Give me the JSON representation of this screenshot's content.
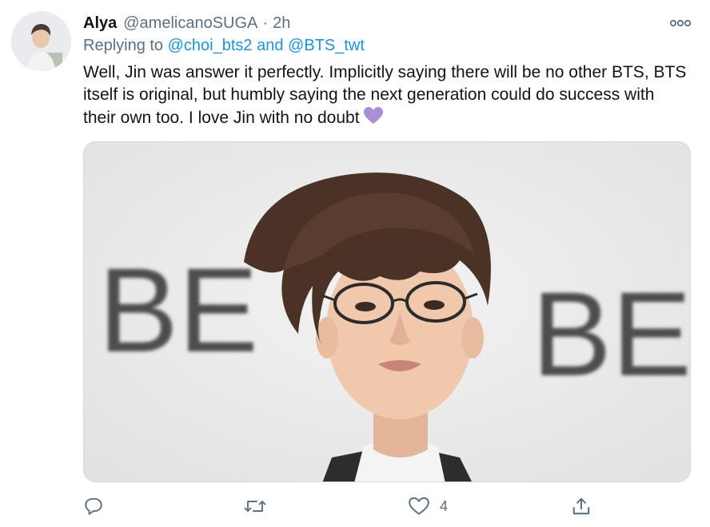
{
  "tweet": {
    "author_name": "Alya",
    "author_handle": "@amelicanoSUGA",
    "separator": "·",
    "time": "2h",
    "reply_prefix": "Replying to",
    "reply_to_1": "@choi_bts2",
    "reply_and": "and",
    "reply_to_2": "@BTS_twt",
    "text": "Well, Jin was answer it perfectly. Implicitly saying there will be no other BTS, BTS itself is original, but humbly saying the next generation could do success with their own too. I love Jin with no doubt",
    "emoji": "purple-heart-icon",
    "media_sign_text": "BE"
  },
  "actions": {
    "like_count": "4",
    "reply_icon": "comment-icon",
    "retweet_icon": "retweet-icon",
    "like_icon": "heart-icon",
    "share_icon": "share-icon"
  },
  "colors": {
    "link": "#1b95e0",
    "secondary_text": "#5b7083",
    "heart_emoji": "#aa8ed6",
    "border": "#cfd9de"
  }
}
